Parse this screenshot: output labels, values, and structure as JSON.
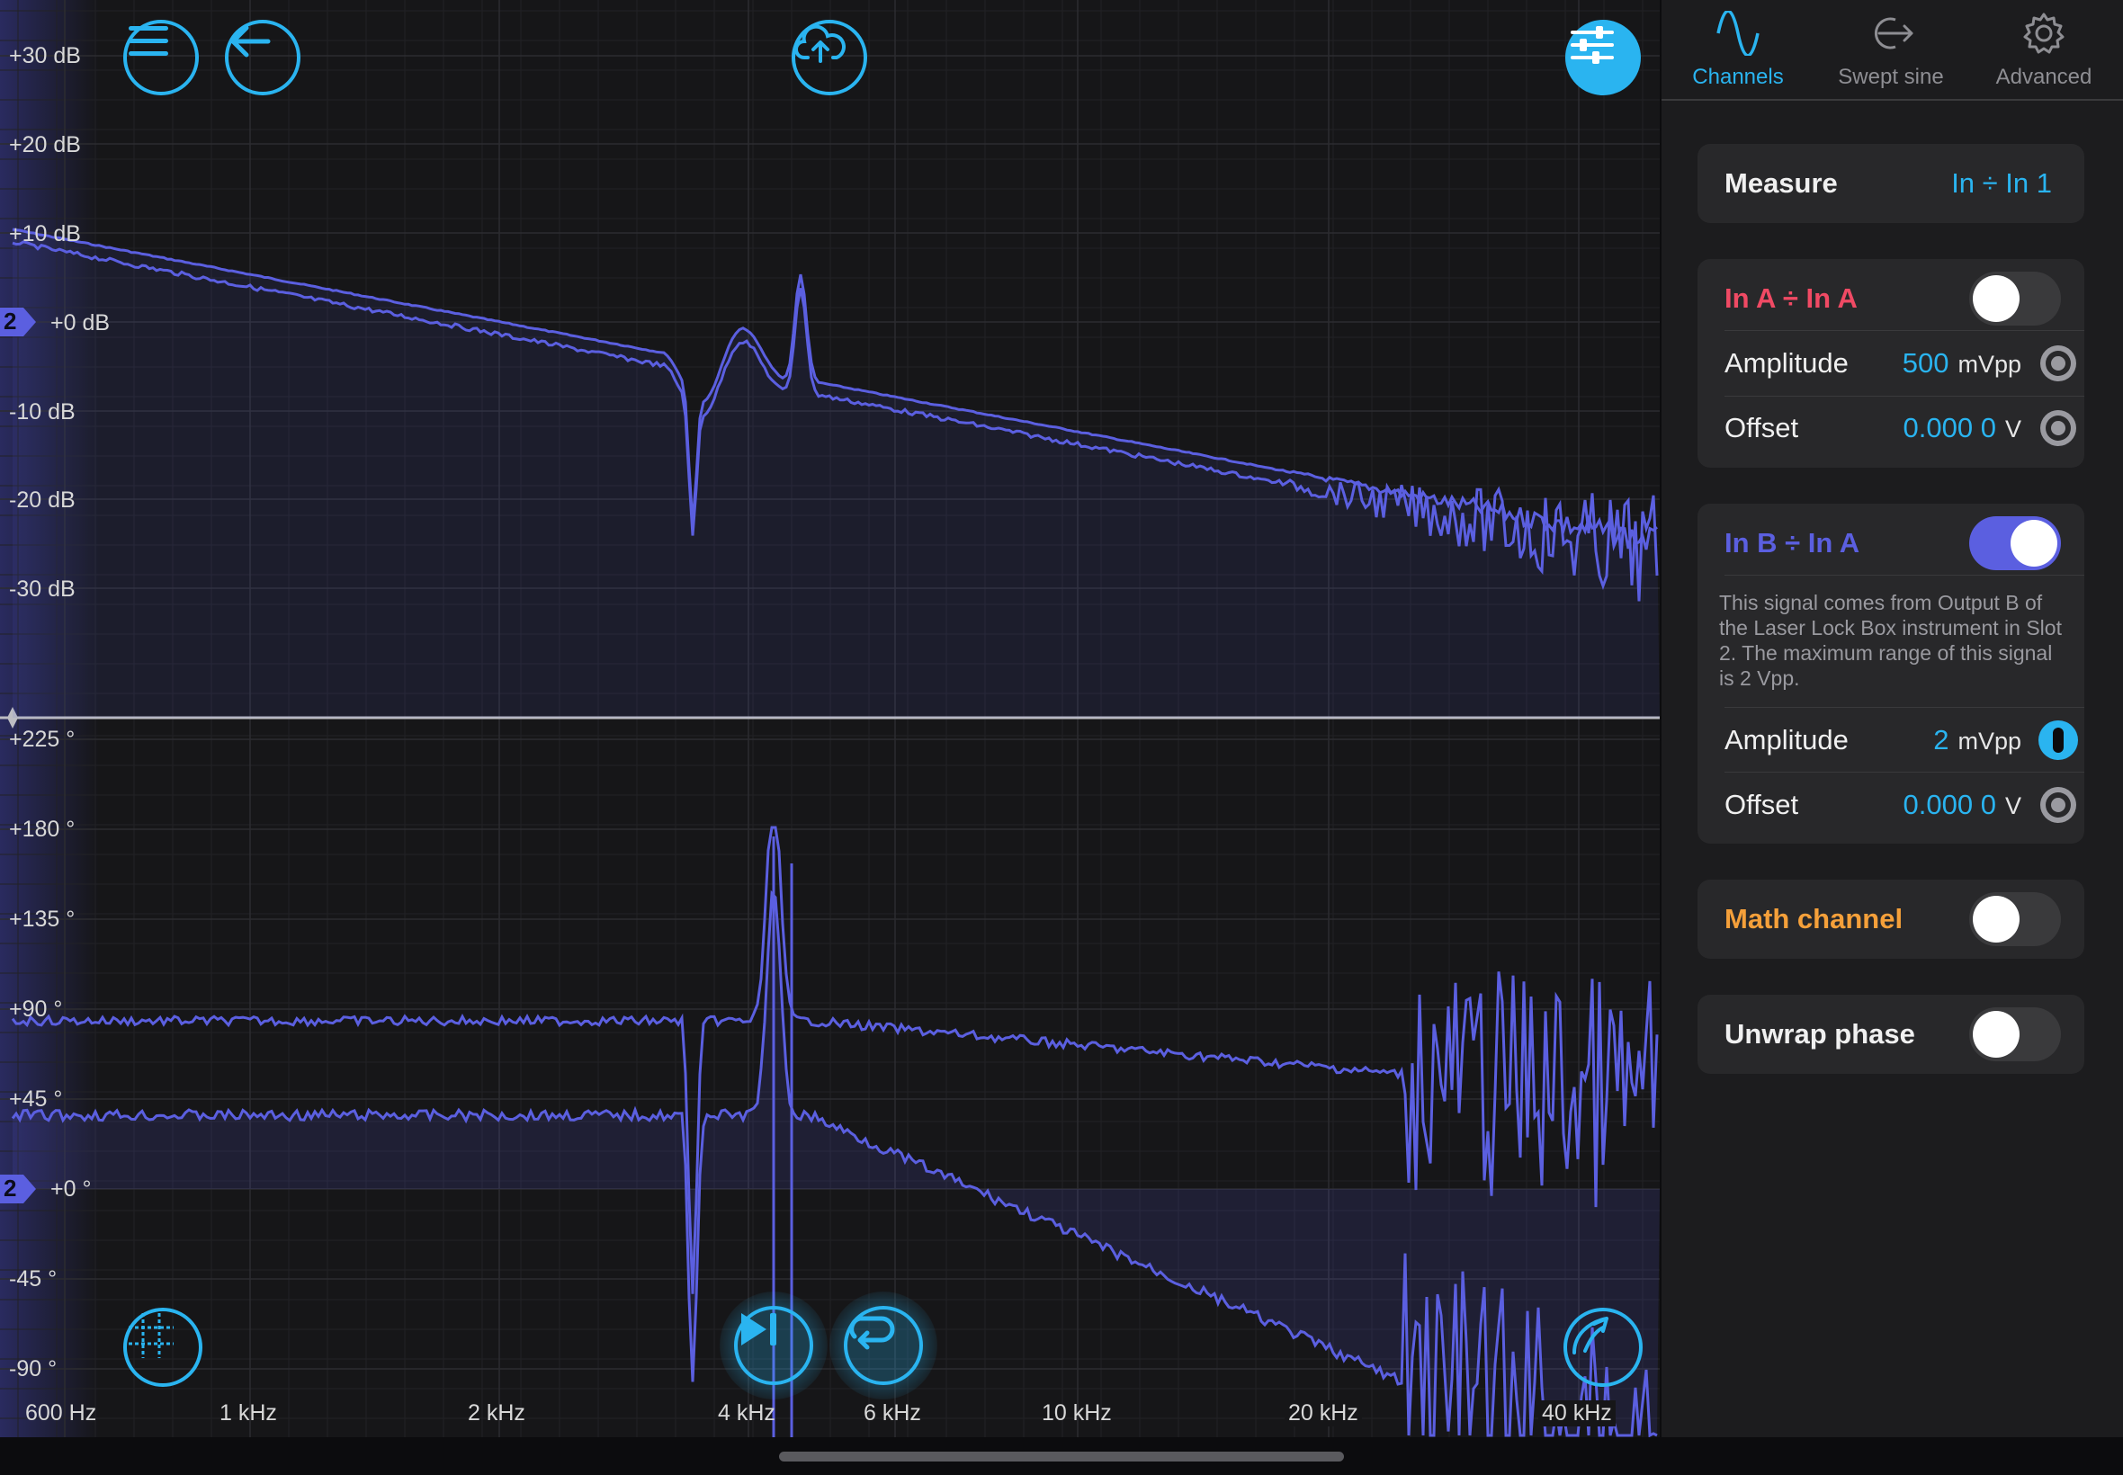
{
  "plot": {
    "magnitude_labels": [
      "+30 dB",
      "+20 dB",
      "+10 dB",
      "+0 dB",
      "-10 dB",
      "-20 dB",
      "-30 dB"
    ],
    "phase_labels": [
      "+225 °",
      "+180 °",
      "+135 °",
      "+90 °",
      "+45 °",
      "+0 °",
      "-45 °",
      "-90 °"
    ],
    "frequency_labels": [
      "600 Hz",
      "1 kHz",
      "2 kHz",
      "4 kHz",
      "6 kHz",
      "10 kHz",
      "20 kHz",
      "40 kHz"
    ],
    "channel_marker": "2",
    "trace_color": "#5b5fe0"
  },
  "toolbar": {
    "menu_icon": "menu-icon",
    "back_icon": "back-arrow-icon",
    "upload_icon": "cloud-upload-icon",
    "settings_icon": "sliders-icon",
    "grid_icon": "grid-icon",
    "play_icon": "skip-forward-icon",
    "repeat_icon": "repeat-icon",
    "draw_icon": "draw-icon",
    "accent": "#2ab4f0"
  },
  "sidebar": {
    "tabs": [
      {
        "label": "Channels",
        "icon": "sine-wave-icon",
        "active": true
      },
      {
        "label": "Swept sine",
        "icon": "swept-sine-icon",
        "active": false
      },
      {
        "label": "Advanced",
        "icon": "gear-icon",
        "active": false
      }
    ],
    "measure": {
      "label": "Measure",
      "value": "In ÷ In 1"
    },
    "channel_a": {
      "title": "In A ÷ In A",
      "title_color": "#f04a64",
      "enabled": false,
      "amplitude_label": "Amplitude",
      "amplitude_value": "500",
      "amplitude_unit": "mVpp",
      "offset_label": "Offset",
      "offset_value": "0.000 0",
      "offset_unit": "V"
    },
    "channel_b": {
      "title": "In B ÷ In A",
      "title_color": "#5b5fe0",
      "enabled": true,
      "description": "This signal comes from Output B of the Laser Lock Box instrument in Slot 2. The maximum range of this signal is 2 Vpp.",
      "amplitude_label": "Amplitude",
      "amplitude_value": "2",
      "amplitude_unit": "mVpp",
      "offset_label": "Offset",
      "offset_value": "0.000 0",
      "offset_unit": "V"
    },
    "math_channel": {
      "label": "Math channel",
      "color": "#f5a03a",
      "enabled": false
    },
    "unwrap_phase": {
      "label": "Unwrap phase",
      "enabled": false
    }
  }
}
